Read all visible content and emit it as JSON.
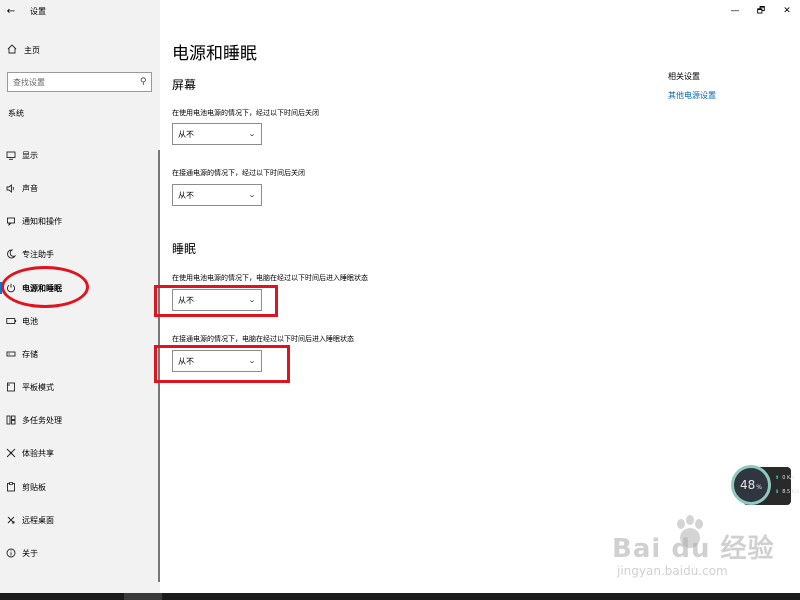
{
  "window": {
    "back_glyph": "←",
    "app_title": "设置",
    "minimize_glyph": "—",
    "maximize_glyph": "🗗",
    "close_glyph": "✕"
  },
  "sidebar": {
    "home_label": "主页",
    "search_placeholder": "查找设置",
    "group_label": "系统",
    "items": [
      {
        "label": "显示",
        "icon": "display-icon"
      },
      {
        "label": "声音",
        "icon": "speaker-icon"
      },
      {
        "label": "通知和操作",
        "icon": "notification-icon"
      },
      {
        "label": "专注助手",
        "icon": "moon-icon"
      },
      {
        "label": "电源和睡眠",
        "icon": "power-icon",
        "selected": true
      },
      {
        "label": "电池",
        "icon": "battery-icon"
      },
      {
        "label": "存储",
        "icon": "storage-icon"
      },
      {
        "label": "平板模式",
        "icon": "tablet-icon"
      },
      {
        "label": "多任务处理",
        "icon": "multitask-icon"
      },
      {
        "label": "体验共享",
        "icon": "share-icon"
      },
      {
        "label": "剪贴板",
        "icon": "clipboard-icon"
      },
      {
        "label": "远程桌面",
        "icon": "remote-desktop-icon"
      },
      {
        "label": "关于",
        "icon": "info-icon"
      }
    ]
  },
  "main": {
    "page_title": "电源和睡眠",
    "screen": {
      "title": "屏幕",
      "battery_label": "在使用电池电源的情况下，经过以下时间后关闭",
      "battery_value": "从不",
      "plugged_label": "在接通电源的情况下，经过以下时间后关闭",
      "plugged_value": "从不"
    },
    "sleep": {
      "title": "睡眠",
      "battery_label": "在使用电池电源的情况下，电脑在经过以下时间后进入睡眠状态",
      "battery_value": "从不",
      "plugged_label": "在接通电源的情况下，电脑在经过以下时间后进入睡眠状态",
      "plugged_value": "从不"
    },
    "related": {
      "title": "相关设置",
      "link": "其他电源设置"
    }
  },
  "widget": {
    "percent": "48",
    "percent_unit": "%",
    "up_value": "0",
    "up_unit": "K/s",
    "down_value": "8.5",
    "down_unit": "K/s"
  },
  "watermark": {
    "logo": "Bai du 经验",
    "url": "jingyan.baidu.com"
  },
  "colors": {
    "accent": "#0078d7",
    "link": "#0067c0",
    "annotation_red": "#e0141e"
  }
}
